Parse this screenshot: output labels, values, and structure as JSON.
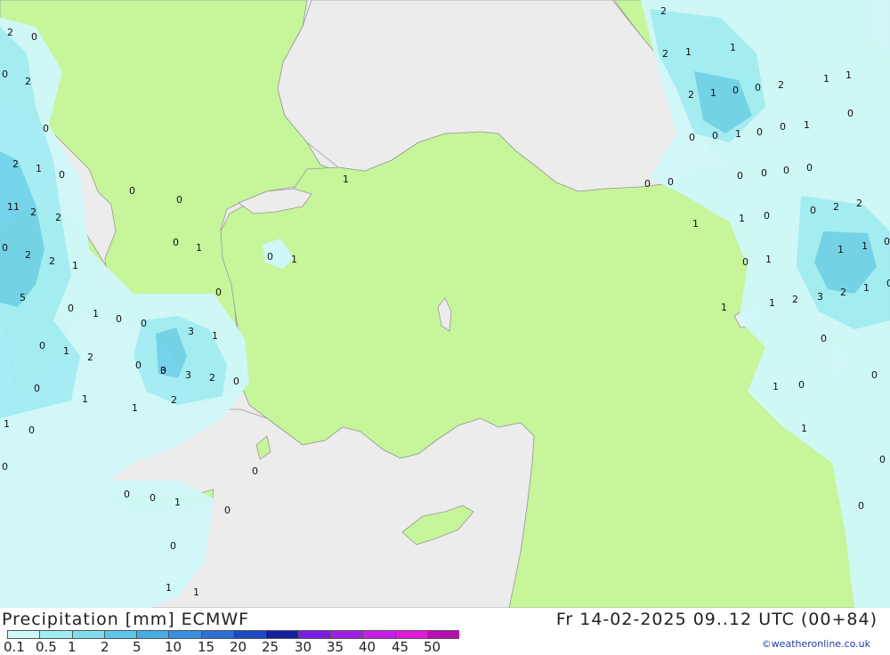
{
  "title": "Precipitation [mm] ECMWF",
  "valid_time": "Fr 14-02-2025 09..12 UTC (00+84)",
  "credit": "©weatheronline.co.uk",
  "colors": {
    "sea": "#ececec",
    "land": "#c6f59a",
    "border": "#999999",
    "precip_light": "#d0f8fa",
    "precip_mid": "#a2ecf4",
    "precip_heavy": "#6fd2ea",
    "precip_core": "#3aa3e6"
  },
  "legend": {
    "labels": [
      "0.1",
      "0.5",
      "1",
      "2",
      "5",
      "10",
      "15",
      "20",
      "25",
      "30",
      "35",
      "40",
      "45",
      "50"
    ],
    "colors": [
      "#d0f8fa",
      "#a2ecf4",
      "#7fdcee",
      "#5ac6e8",
      "#46aee4",
      "#3a8ee0",
      "#2e6fd6",
      "#1d48c4",
      "#1420a0",
      "#7a1ce6",
      "#a11ee6",
      "#c61ee8",
      "#e01ad8",
      "#b80fb0"
    ]
  },
  "map_values": [
    {
      "v": "2"
    },
    {
      "v": "0"
    },
    {
      "v": "0"
    },
    {
      "v": "2"
    },
    {
      "v": "0"
    },
    {
      "v": "2"
    },
    {
      "v": "1"
    },
    {
      "v": "0"
    },
    {
      "v": "11"
    },
    {
      "v": "2"
    },
    {
      "v": "2"
    },
    {
      "v": "0"
    },
    {
      "v": "2"
    },
    {
      "v": "2"
    },
    {
      "v": "1"
    },
    {
      "v": "5"
    },
    {
      "v": "0"
    },
    {
      "v": "0"
    },
    {
      "v": "0"
    },
    {
      "v": "1"
    },
    {
      "v": "0"
    },
    {
      "v": "1"
    },
    {
      "v": "0"
    },
    {
      "v": "0"
    },
    {
      "v": "0"
    },
    {
      "v": "0"
    },
    {
      "v": "1"
    },
    {
      "v": "0"
    },
    {
      "v": "0"
    },
    {
      "v": "1"
    },
    {
      "v": "0"
    },
    {
      "v": "3"
    },
    {
      "v": "2"
    },
    {
      "v": "0"
    },
    {
      "v": "3"
    },
    {
      "v": "1"
    },
    {
      "v": "3"
    },
    {
      "v": "2"
    },
    {
      "v": "2"
    },
    {
      "v": "0"
    },
    {
      "v": "0"
    },
    {
      "v": "0"
    },
    {
      "v": "1"
    },
    {
      "v": "1"
    },
    {
      "v": "1"
    },
    {
      "v": "0"
    },
    {
      "v": "0"
    },
    {
      "v": "0"
    },
    {
      "v": "1"
    },
    {
      "v": "0"
    },
    {
      "v": "1"
    },
    {
      "v": "1"
    },
    {
      "v": "0"
    },
    {
      "v": "1"
    },
    {
      "v": "2"
    },
    {
      "v": "2"
    },
    {
      "v": "1"
    },
    {
      "v": "1"
    },
    {
      "v": "2"
    },
    {
      "v": "1"
    },
    {
      "v": "0"
    },
    {
      "v": "0"
    },
    {
      "v": "1"
    },
    {
      "v": "0"
    },
    {
      "v": "0"
    },
    {
      "v": "2"
    },
    {
      "v": "1"
    },
    {
      "v": "1"
    },
    {
      "v": "0"
    },
    {
      "v": "0"
    },
    {
      "v": "1"
    },
    {
      "v": "0"
    },
    {
      "v": "0"
    },
    {
      "v": "0"
    },
    {
      "v": "0"
    },
    {
      "v": "0"
    },
    {
      "v": "0"
    },
    {
      "v": "0"
    },
    {
      "v": "1"
    },
    {
      "v": "0"
    },
    {
      "v": "1"
    },
    {
      "v": "0"
    },
    {
      "v": "2"
    },
    {
      "v": "2"
    },
    {
      "v": "1"
    },
    {
      "v": "1"
    },
    {
      "v": "0"
    },
    {
      "v": "0"
    },
    {
      "v": "1"
    },
    {
      "v": "1"
    },
    {
      "v": "2"
    },
    {
      "v": "3"
    },
    {
      "v": "2"
    },
    {
      "v": "1"
    },
    {
      "v": "0"
    },
    {
      "v": "1"
    },
    {
      "v": "0"
    },
    {
      "v": "0"
    },
    {
      "v": "1"
    },
    {
      "v": "0"
    },
    {
      "v": "1"
    },
    {
      "v": "0"
    },
    {
      "v": "0"
    }
  ]
}
